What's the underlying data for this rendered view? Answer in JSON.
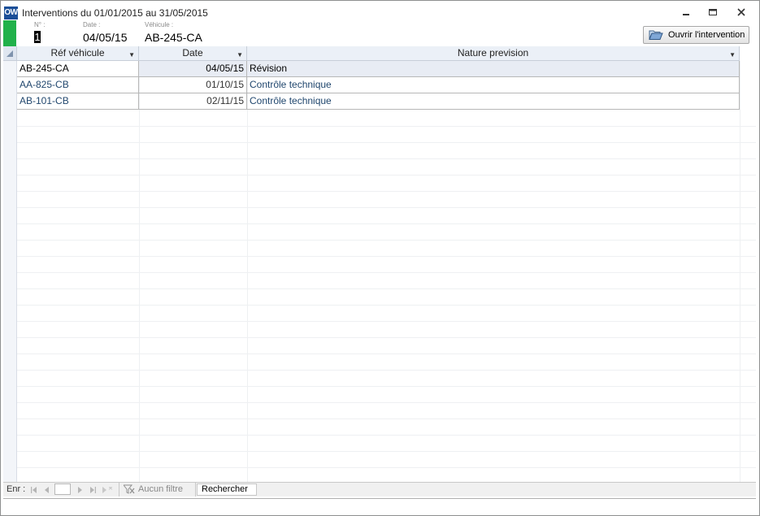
{
  "window": {
    "app_icon_text": "OW",
    "title": "Interventions du 01/01/2015 au 31/05/2015"
  },
  "header": {
    "num_label": "N° :",
    "num_value": "1",
    "date_label": "Date :",
    "date_value": "04/05/15",
    "vehicle_label": "Véhicule :",
    "vehicle_value": "AB-245-CA",
    "open_button_label": "Ouvrir l'intervention",
    "record_indicator_color": "#21b14a"
  },
  "grid": {
    "columns": [
      "Réf véhicule",
      "Date",
      "Nature prevision"
    ],
    "rows": [
      {
        "ref": "AB-245-CA",
        "date": "04/05/15",
        "nature": "Révision"
      },
      {
        "ref": "AA-825-CB",
        "date": "01/10/15",
        "nature": "Contrôle technique"
      },
      {
        "ref": "AB-101-CB",
        "date": "02/11/15",
        "nature": "Contrôle technique"
      }
    ],
    "selected_row_index": 0
  },
  "navbar": {
    "record_label": "Enr :",
    "record_value": "",
    "filter_label": "Aucun filtre",
    "search_label": "Rechercher"
  }
}
